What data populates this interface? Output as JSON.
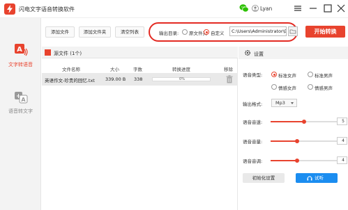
{
  "app": {
    "title": "闪电文字语音转换软件",
    "user_name": "Lyan",
    "accent_color": "#e8432e",
    "icons": [
      "app-logo-icon",
      "wechat-icon",
      "user-icon",
      "menu-icon",
      "minimize-icon",
      "maximize-icon",
      "close-icon"
    ]
  },
  "sidebar": {
    "items": [
      {
        "label": "文字转语音",
        "icon": "text-to-speech-icon",
        "active": true
      },
      {
        "label": "语音转文字",
        "icon": "speech-to-text-icon",
        "active": false
      }
    ]
  },
  "toolbar": {
    "add_file": "添加文件",
    "add_folder": "添加文件夹",
    "clear_list": "清空列表",
    "output_label": "输出目录:",
    "radio_source": "原文件夹",
    "radio_custom": "自定义",
    "output_selected": "自定义",
    "output_path": "C:\\Users\\Administrator\\De",
    "start_button": "开始转换"
  },
  "file_list": {
    "title": "源文件 (1个)",
    "columns": [
      "文件名称",
      "大小",
      "字数",
      "转换进度",
      "移除"
    ],
    "rows": [
      {
        "name": "英语作文-珍贵的回忆.txt",
        "size": "339.00 B",
        "words": "338",
        "progress": "0%",
        "progress_value": 0
      }
    ]
  },
  "settings": {
    "title": "设置",
    "voice_type_label": "语音类型:",
    "voice_options": [
      "标准女声",
      "标准男声",
      "情感女声",
      "情感男声"
    ],
    "voice_selected": "标准女声",
    "format_label": "输出格式:",
    "format_value": "Mp3",
    "speed_label": "语音音速:",
    "speed_value": "5",
    "speed_fraction": 0.5,
    "volume_label": "语音音量:",
    "volume_value": "4",
    "volume_fraction": 0.4,
    "pitch_label": "语音音调:",
    "pitch_value": "4",
    "pitch_fraction": 0.4,
    "init_button": "初始化设置",
    "try_button": "试听"
  }
}
